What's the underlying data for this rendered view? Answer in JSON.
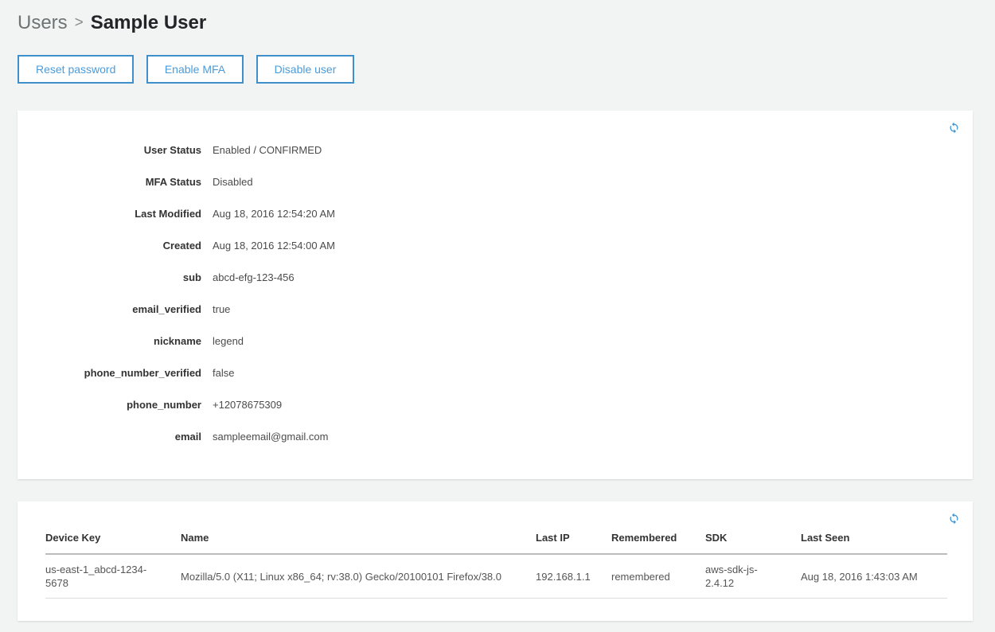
{
  "breadcrumb": {
    "section": "Users",
    "separator": ">",
    "current": "Sample User"
  },
  "actions": {
    "reset_password": "Reset password",
    "enable_mfa": "Enable MFA",
    "disable_user": "Disable user"
  },
  "details": {
    "rows": [
      {
        "label": "User Status",
        "value": "Enabled / CONFIRMED"
      },
      {
        "label": "MFA Status",
        "value": "Disabled"
      },
      {
        "label": "Last Modified",
        "value": "Aug 18, 2016 12:54:20 AM"
      },
      {
        "label": "Created",
        "value": "Aug 18, 2016 12:54:00 AM"
      },
      {
        "label": "sub",
        "value": "abcd-efg-123-456"
      },
      {
        "label": "email_verified",
        "value": "true"
      },
      {
        "label": "nickname",
        "value": "legend"
      },
      {
        "label": "phone_number_verified",
        "value": "false"
      },
      {
        "label": "phone_number",
        "value": "+12078675309"
      },
      {
        "label": "email",
        "value": "sampleemail@gmail.com"
      }
    ]
  },
  "devices": {
    "columns": [
      "Device Key",
      "Name",
      "Last IP",
      "Remembered",
      "SDK",
      "Last Seen"
    ],
    "rows": [
      {
        "device_key": "us-east-1_abcd-1234-5678",
        "name": "Mozilla/5.0 (X11; Linux x86_64; rv:38.0) Gecko/20100101 Firefox/38.0",
        "last_ip": "192.168.1.1",
        "remembered": "remembered",
        "sdk": "aws-sdk-js-2.4.12",
        "last_seen": "Aug 18, 2016 1:43:03 AM"
      }
    ]
  },
  "icons": {
    "refresh": "refresh-icon"
  },
  "colors": {
    "background": "#f2f4f4",
    "accent_blue_border": "#3e8fca",
    "accent_blue_text": "#4c9cd9",
    "refresh_icon_blue": "#3590d2",
    "breadcrumb_gray": "#6e7374",
    "title_dark": "#222527"
  }
}
